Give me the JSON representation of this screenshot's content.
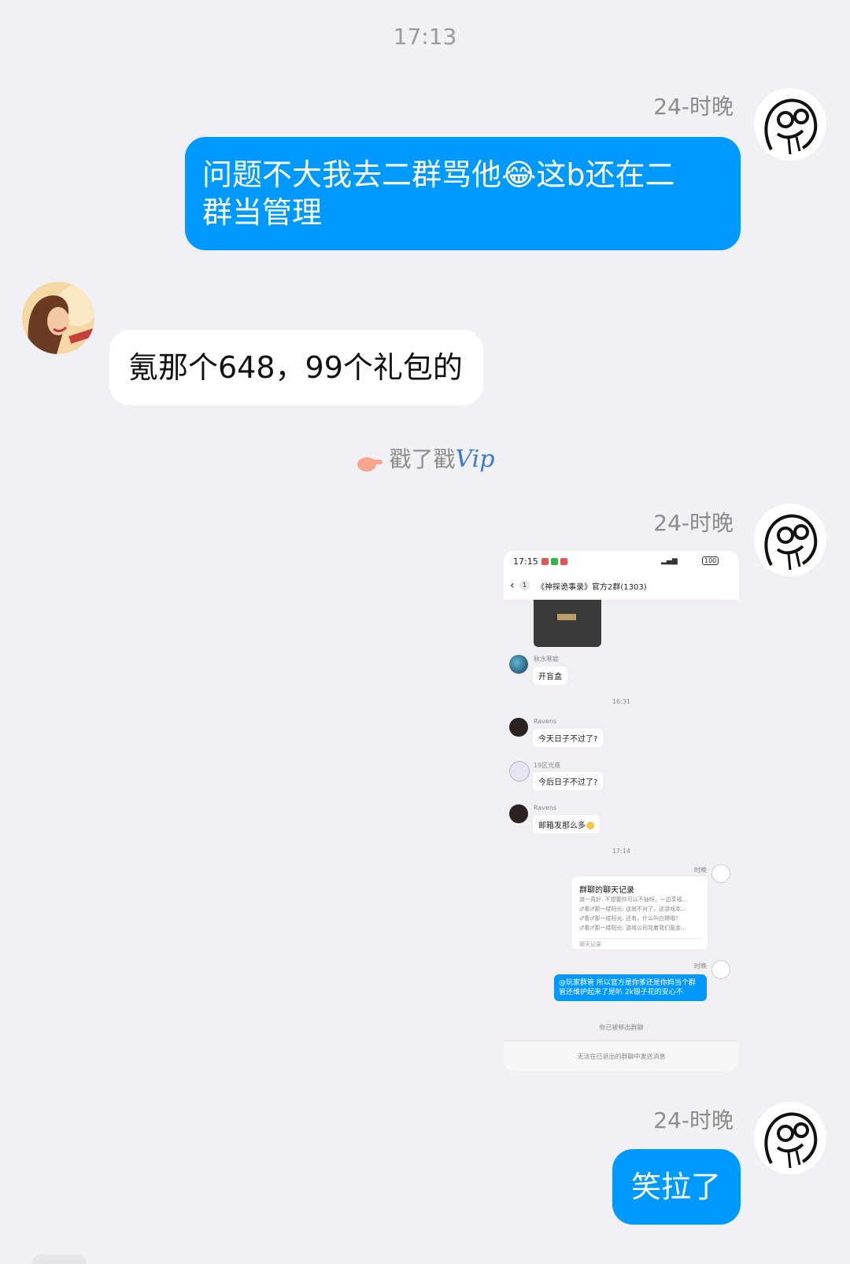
{
  "time_divider": "17:13",
  "messages": {
    "m1": {
      "sender": "24-时晚",
      "text_a": "问题不大我去二群骂他",
      "emoji": "😂",
      "text_b": "这b还在二",
      "text_c": "群当管理"
    },
    "m2": {
      "text": "氪那个648，99个礼包的"
    },
    "poke": {
      "text": "戳了戳",
      "vip": "Vip"
    },
    "m3": {
      "sender": "24-时晚"
    },
    "m4": {
      "sender": "24-时晚",
      "text": "笑拉了"
    }
  },
  "embedded_screenshot": {
    "status_time": "17:15",
    "status_battery": "100",
    "nav_back_count": "1",
    "nav_title": "《神探诡事录》官方2群(1303)",
    "msg1": {
      "name": "秋水寒庭",
      "text": "开盲盒"
    },
    "time1": "16:31",
    "msg2": {
      "name": "Ravens",
      "text": "今天日子不过了?"
    },
    "msg3": {
      "name": "19区光熹",
      "text": "今后日子不过了?"
    },
    "msg4": {
      "name": "Ravens",
      "text": "邮箱发那么多"
    },
    "time2": "17:14",
    "self_name": "时晚",
    "record_card": {
      "title": "群聊的聊天记录",
      "lines": [
        "渡一真好: 不想要你可以不抽呀，一边享福...",
        "♂看♂那一缕阳光: 这就不对了，这游戏本...",
        "♂看♂那一缕阳光: 还有，什么叫白嫖哦?",
        "♂看♂那一缕阳光: 游戏公司花着我们氪金..."
      ],
      "footer": "聊天记录"
    },
    "self_msg": "@玩家群管 所以官方是你爹还是你妈当个群管还维护起来了是叭 2k银子花的安心不",
    "removed_notice": "你已被移出群聊",
    "input_disabled": "无法在已退出的群聊中发送消息"
  },
  "colors": {
    "bubble_out": "#0099ff",
    "background": "#f0f0f5"
  }
}
